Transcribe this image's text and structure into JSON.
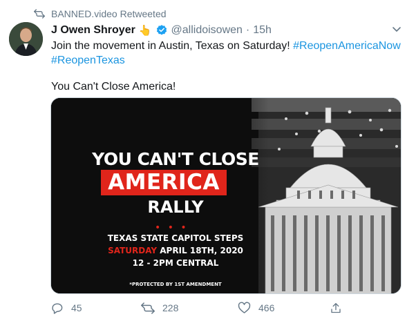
{
  "retweet_banner": {
    "label": "BANNED.video Retweeted",
    "icon": "retweet-icon"
  },
  "author": {
    "name": "J Owen Shroyer",
    "emoji": "👆",
    "verified": true,
    "handle": "@allidoisowen",
    "separator": "·",
    "time": "15h"
  },
  "tweet": {
    "line1_text": "Join the movement in Austin, Texas on Saturday! ",
    "hashtag1": "#ReopenAmericaNow",
    "hashtag2": "#ReopenTexas",
    "line3": "You Can't Close America!"
  },
  "media": {
    "line1": "YOU CAN'T CLOSE",
    "line2": "AMERICA",
    "line3": "RALLY",
    "venue": "TEXAS STATE CAPITOL STEPS",
    "day": "SATURDAY",
    "date": "APRIL 18TH, 2020",
    "time": "12 - 2PM CENTRAL",
    "footer": "*PROTECTED BY 1ST AMENDMENT",
    "accent_color": "#e0251b"
  },
  "actions": {
    "reply_count": "45",
    "retweet_count": "228",
    "like_count": "466"
  },
  "colors": {
    "text_primary": "#14171a",
    "text_secondary": "#657786",
    "link": "#1b95e0",
    "verified": "#1da1f2"
  }
}
